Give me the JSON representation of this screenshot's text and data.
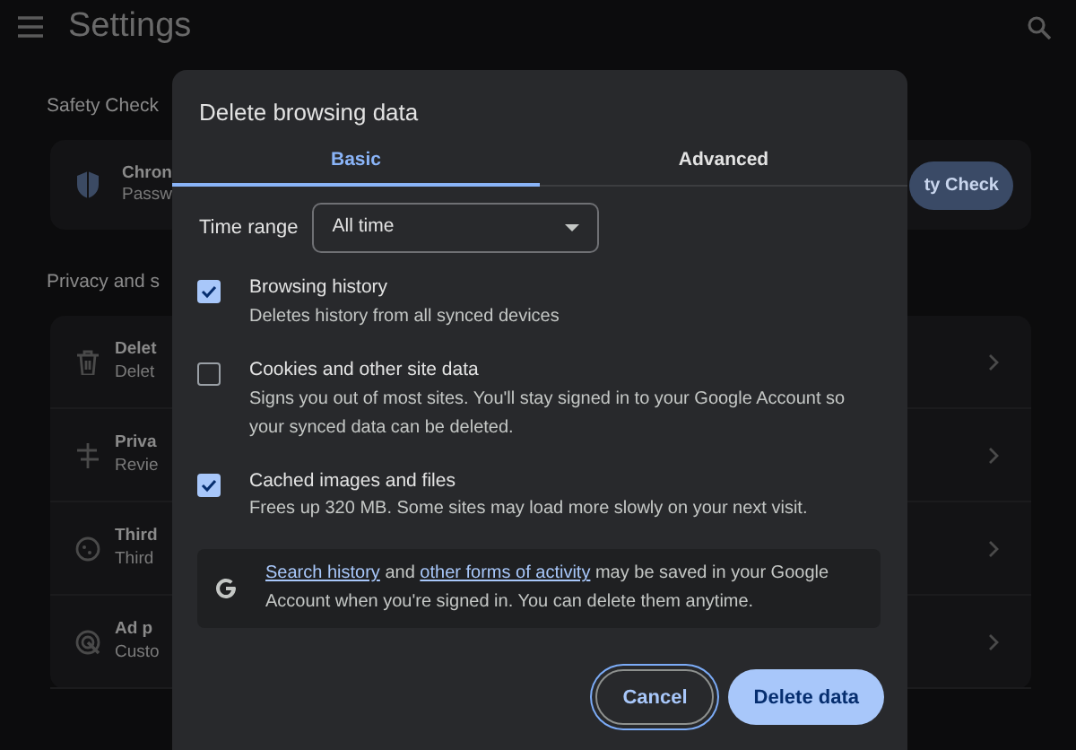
{
  "header": {
    "title": "Settings"
  },
  "safety_check": {
    "heading": "Safety Check",
    "item_title": "Chron",
    "item_subtitle": "Passw",
    "button": "ty Check"
  },
  "privacy": {
    "heading": "Privacy and s",
    "items": [
      {
        "kind": "trash",
        "title": "Delet",
        "subtitle": "Delet"
      },
      {
        "kind": "sliders",
        "title": "Priva",
        "subtitle": "Revie"
      },
      {
        "kind": "cookie",
        "title": "Third",
        "subtitle": "Third"
      },
      {
        "kind": "ad",
        "title": "Ad p",
        "subtitle": "Custo"
      }
    ]
  },
  "dialog": {
    "title": "Delete browsing data",
    "tabs": [
      {
        "label": "Basic",
        "selected": true
      },
      {
        "label": "Advanced",
        "selected": false
      }
    ],
    "time_range": {
      "label": "Time range",
      "value": "All time"
    },
    "options": [
      {
        "title": "Browsing history",
        "description": "Deletes history from all synced devices",
        "checked": true
      },
      {
        "title": "Cookies and other site data",
        "description": "Signs you out of most sites. You'll stay signed in to your Google Account so your synced data can be deleted.",
        "checked": false
      },
      {
        "title": "Cached images and files",
        "description": "Frees up 320 MB. Some sites may load more slowly on your next visit.",
        "checked": true
      }
    ],
    "notice": [
      {
        "text": "Search history",
        "link": true
      },
      {
        "text": " and ",
        "link": false
      },
      {
        "text": "other forms of activity",
        "link": true
      },
      {
        "text": " may be saved in your Google Account when you're signed in. You can delete them anytime.",
        "link": false
      }
    ],
    "buttons": [
      {
        "label": "Cancel",
        "kind": "secondary"
      },
      {
        "label": "Delete data",
        "kind": "primary"
      }
    ]
  }
}
